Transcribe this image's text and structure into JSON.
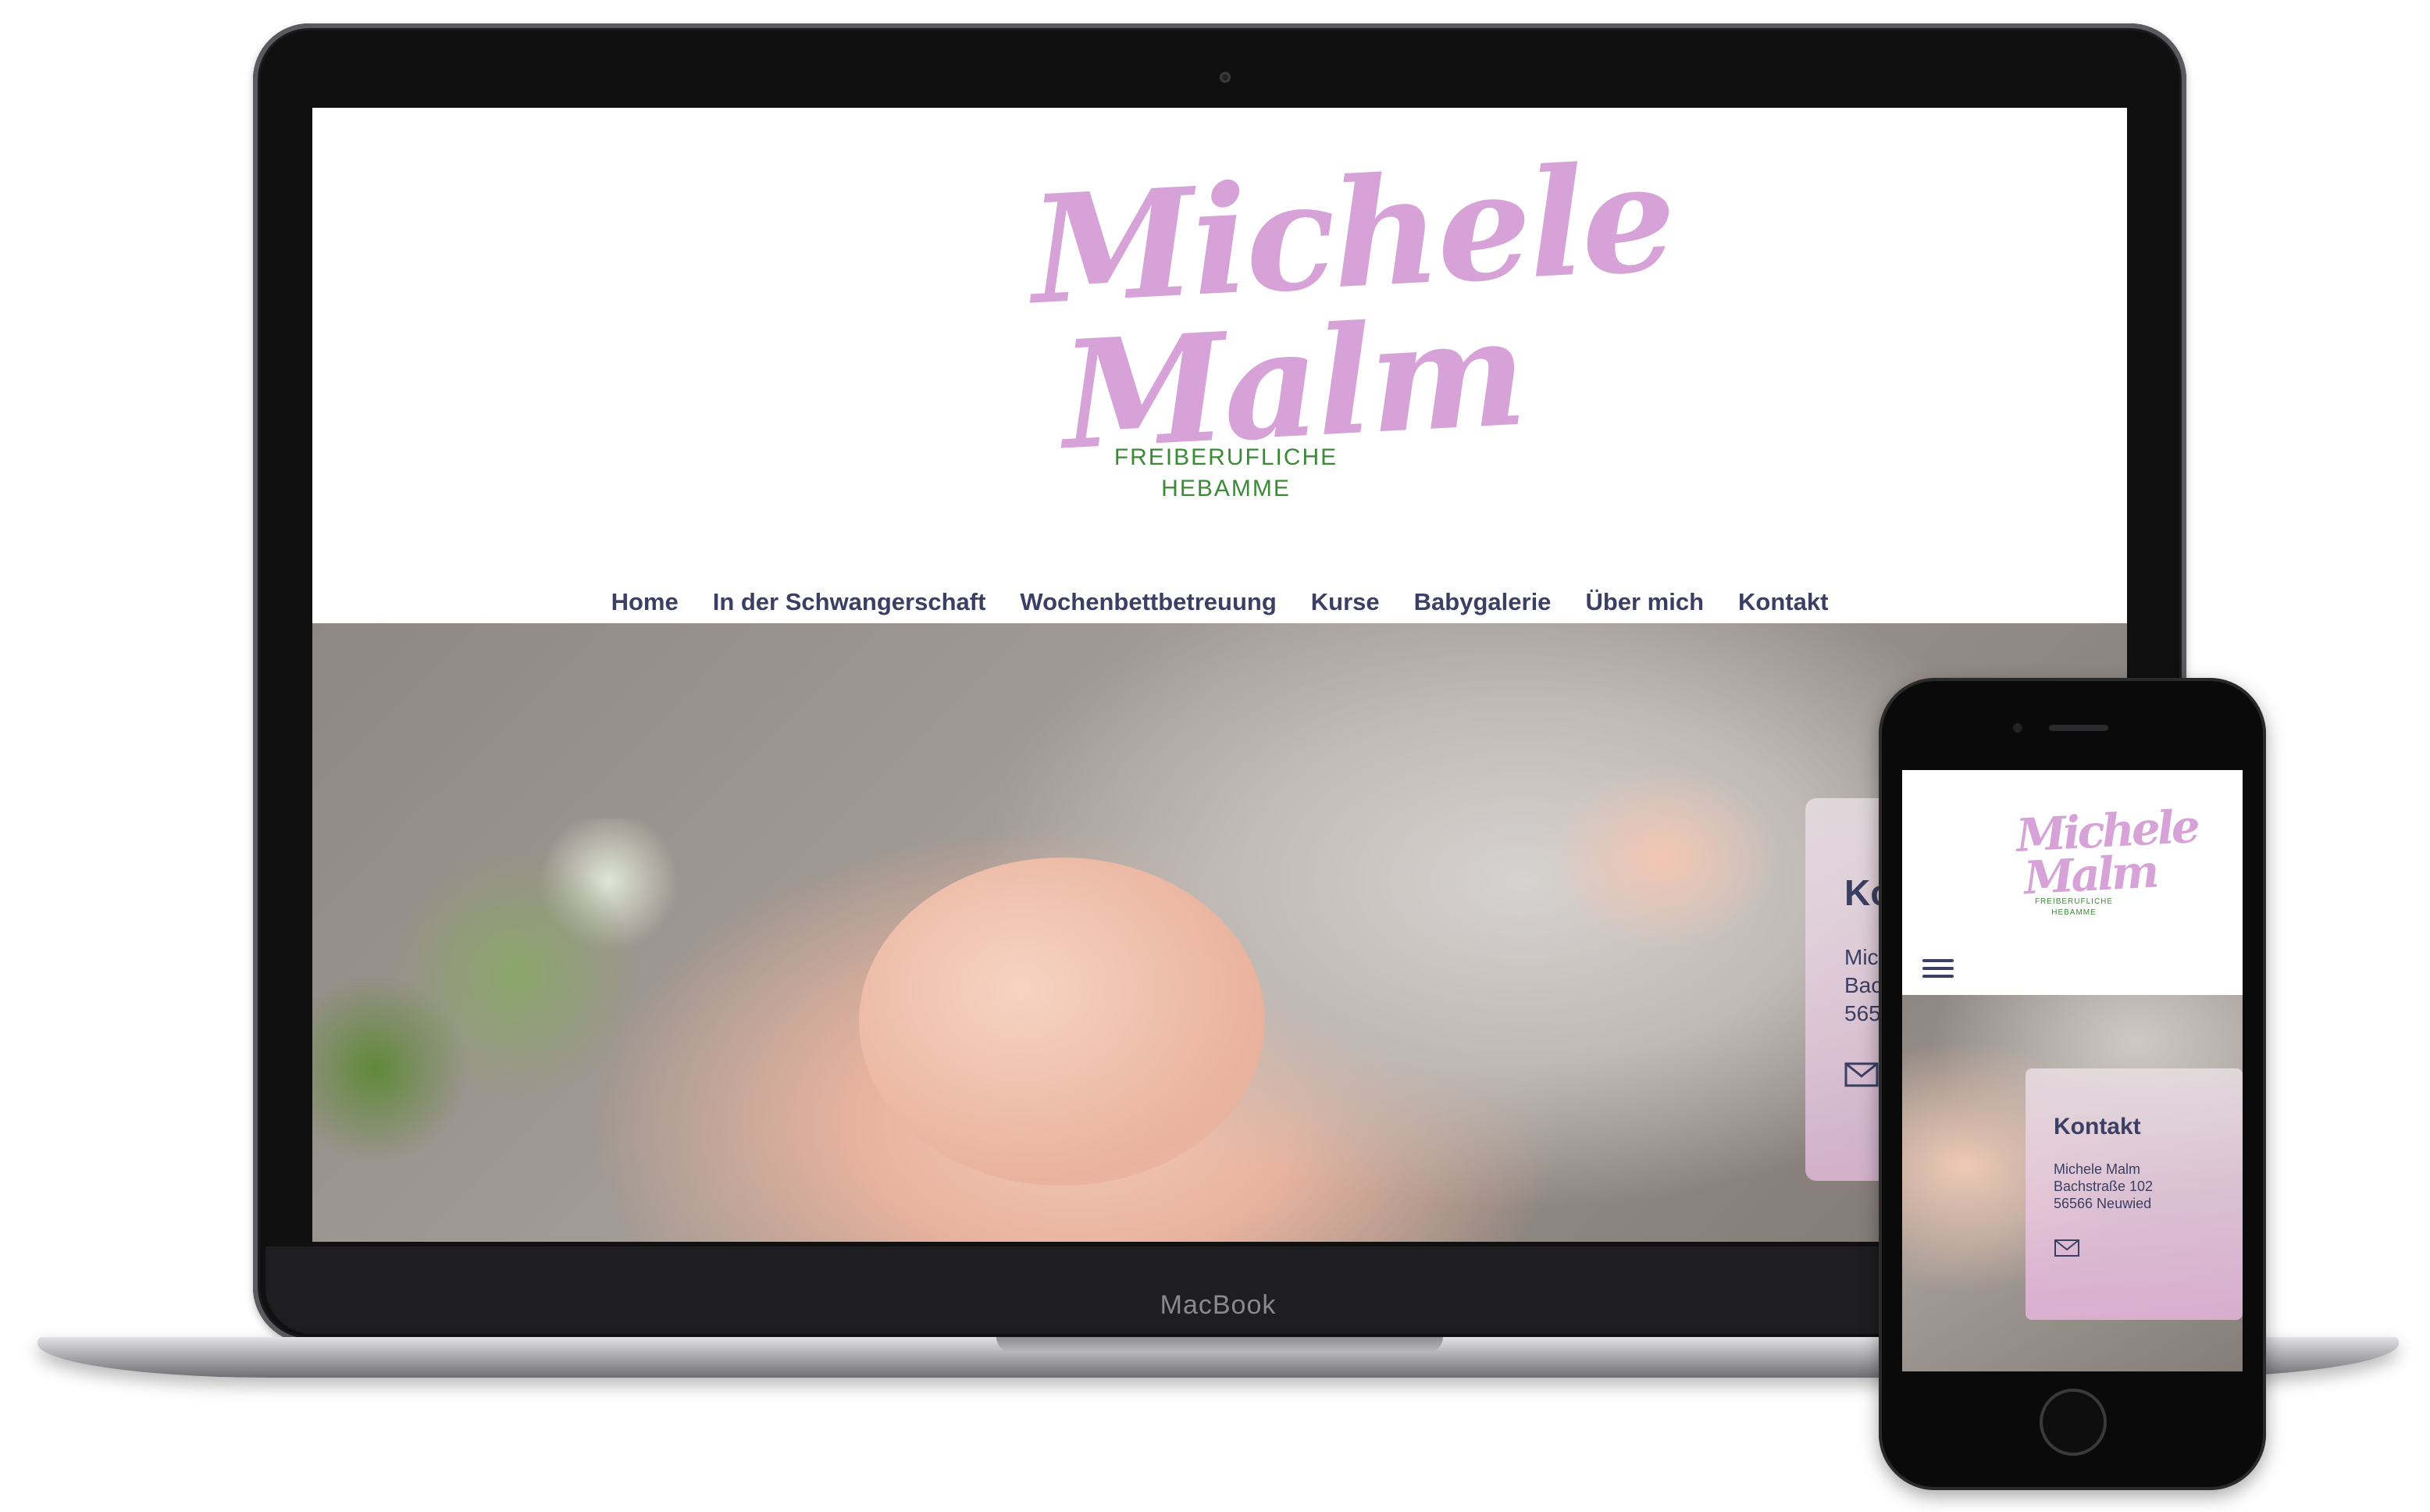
{
  "brand": {
    "name_line1": "Michele",
    "name_line2": "Malm",
    "tagline_line1": "FREIBERUFLICHE",
    "tagline_line2": "HEBAMME",
    "logo_color": "#d7a2d7",
    "tagline_color": "#3b8a35"
  },
  "nav": {
    "items": [
      "Home",
      "In der Schwangerschaft",
      "Wochenbettbetreuung",
      "Kurse",
      "Babygalerie",
      "Über mich",
      "Kontakt"
    ],
    "color": "#3a3f63"
  },
  "contact_card": {
    "title": "Kontakt",
    "title_partial": "Ko",
    "line1": "Michele Malm",
    "line2": "Bachstraße 102",
    "line3": "56566 Neuwied",
    "line1_partial": "Mic",
    "line2_partial": "Bac",
    "line3_partial": "565",
    "mail_icon": "mail-icon"
  },
  "device": {
    "laptop_label": "MacBook"
  },
  "mobile": {
    "menu_icon": "hamburger-menu-icon"
  }
}
